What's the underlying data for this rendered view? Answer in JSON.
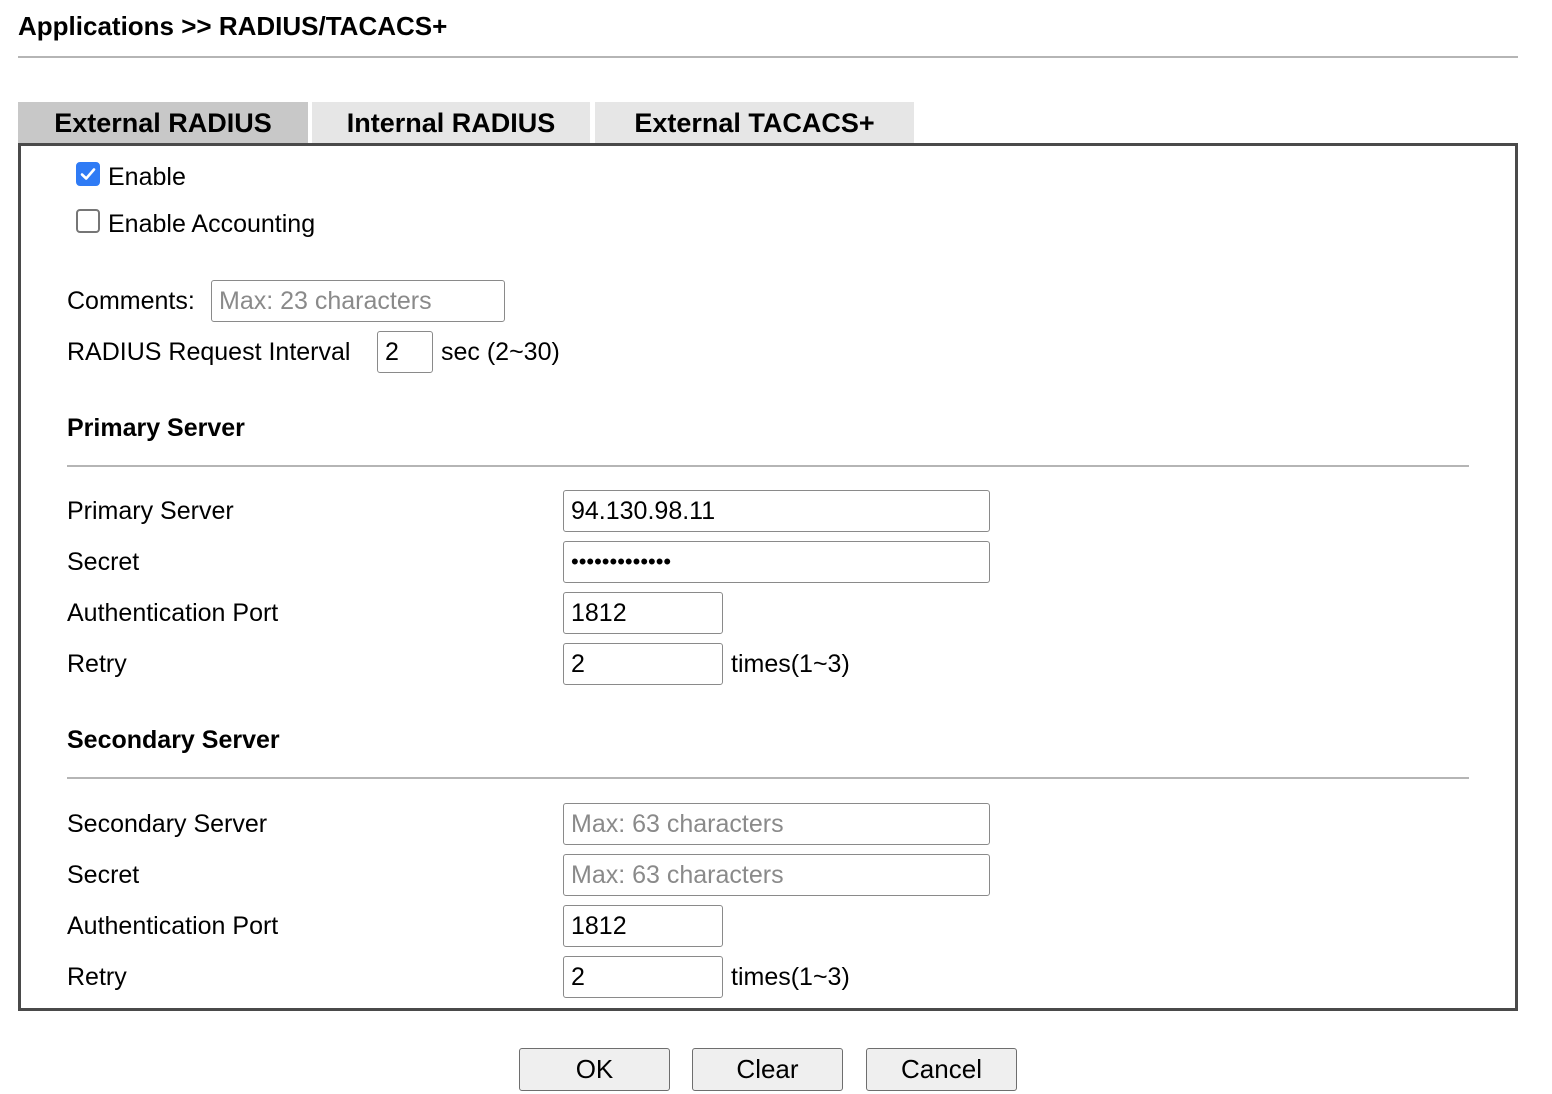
{
  "header": {
    "breadcrumb": "Applications >> RADIUS/TACACS+"
  },
  "tabs": [
    {
      "label": "External RADIUS",
      "active": true
    },
    {
      "label": "Internal RADIUS",
      "active": false
    },
    {
      "label": "External TACACS+",
      "active": false
    }
  ],
  "options": {
    "enable": {
      "label": "Enable",
      "checked": true
    },
    "enable_accounting": {
      "label": "Enable Accounting",
      "checked": false
    }
  },
  "comments": {
    "label": "Comments:",
    "value": "",
    "placeholder": "Max: 23 characters"
  },
  "request_interval": {
    "label": "RADIUS Request Interval",
    "value": "2",
    "unit": "sec (2~30)"
  },
  "primary": {
    "heading": "Primary Server",
    "server_label": "Primary Server",
    "server_value": "94.130.98.11",
    "secret_label": "Secret",
    "secret_value": "•••••••••••••",
    "auth_port_label": "Authentication Port",
    "auth_port_value": "1812",
    "retry_label": "Retry",
    "retry_value": "2",
    "retry_unit": "times(1~3)"
  },
  "secondary": {
    "heading": "Secondary Server",
    "server_label": "Secondary Server",
    "server_placeholder": "Max: 63 characters",
    "secret_label": "Secret",
    "secret_placeholder": "Max: 63 characters",
    "auth_port_label": "Authentication Port",
    "auth_port_value": "1812",
    "retry_label": "Retry",
    "retry_value": "2",
    "retry_unit": "times(1~3)"
  },
  "buttons": {
    "ok": "OK",
    "clear": "Clear",
    "cancel": "Cancel"
  },
  "colors": {
    "checkbox_checked": "#2f7bf5",
    "tab_active": "#c8c8c8",
    "tab_inactive": "#e6e6e6",
    "panel_border": "#4a4a4a"
  }
}
